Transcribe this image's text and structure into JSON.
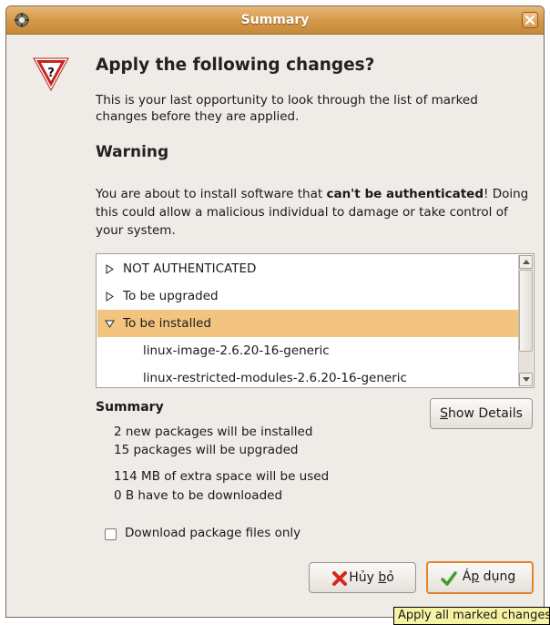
{
  "window": {
    "title": "Summary"
  },
  "main": {
    "heading": "Apply the following changes?",
    "intro": "This is your last opportunity to look through the list of marked changes before they are applied.",
    "warning_heading": "Warning",
    "warning": {
      "pre": "You are about to install software that ",
      "bold": "can't be authenticated",
      "post": "! Doing this could allow a malicious individual to damage or take control of your system."
    }
  },
  "list": {
    "rows": [
      {
        "label": "NOT AUTHENTICATED",
        "expanded": false
      },
      {
        "label": "To be upgraded",
        "expanded": false
      },
      {
        "label": "To be installed",
        "expanded": true,
        "selected": true
      },
      {
        "label": "linux-image-2.6.20-16-generic",
        "child": true
      },
      {
        "label": "linux-restricted-modules-2.6.20-16-generic",
        "child": true
      }
    ]
  },
  "summary": {
    "heading": "Summary",
    "show_details": {
      "pre": "",
      "mnemonic": "S",
      "post": "how Details"
    },
    "lines": [
      "2 new packages will be installed",
      "15 packages will be upgraded",
      "114 MB of extra space will be used",
      "0  B have to be downloaded"
    ]
  },
  "options": {
    "download_only": "Download package files only"
  },
  "buttons": {
    "cancel": {
      "pre": "Hủy ",
      "mnemonic": "b",
      "post": "ỏ"
    },
    "apply": {
      "pre": "Á",
      "mnemonic": "p",
      "post": " dụng"
    }
  },
  "tooltip": "Apply all marked changes",
  "colors": {
    "titlebar": "#d49a4a",
    "selection": "#f2c480",
    "focus_border": "#e3832a",
    "tooltip_bg": "#f7f3a5"
  }
}
